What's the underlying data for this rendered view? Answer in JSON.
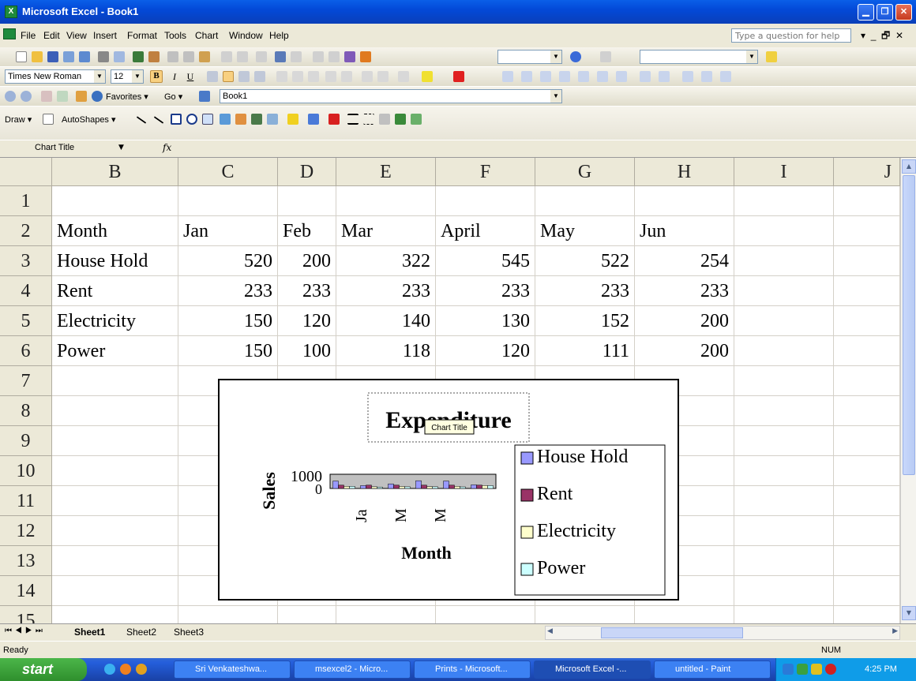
{
  "window": {
    "title": "Microsoft Excel - Book1",
    "app_icon": "excel-icon"
  },
  "menu": {
    "items": [
      "File",
      "Edit",
      "View",
      "Insert",
      "Format",
      "Tools",
      "Chart",
      "Window",
      "Help"
    ],
    "help_placeholder": "Type a question for help"
  },
  "formatting": {
    "font": "Times New Roman",
    "size": "12"
  },
  "web_toolbar": {
    "favorites": "Favorites ▾",
    "go": "Go ▾",
    "address": "Book1"
  },
  "drawing": {
    "draw": "Draw ▾",
    "autoshapes": "AutoShapes ▾"
  },
  "formula_bar": {
    "name_box": "Chart Title",
    "fx": "fx"
  },
  "columns": [
    "B",
    "C",
    "D",
    "E",
    "F",
    "G",
    "H",
    "I",
    "J"
  ],
  "rows": [
    "1",
    "2",
    "3",
    "4",
    "5",
    "6",
    "7",
    "8",
    "9",
    "10",
    "11",
    "12",
    "13",
    "14",
    "15"
  ],
  "table": {
    "header": [
      "Month",
      "Jan",
      "Feb",
      "Mar",
      "April",
      "May",
      "Jun"
    ],
    "data": [
      [
        "House Hold",
        "520",
        "200",
        "322",
        "545",
        "522",
        "254"
      ],
      [
        "Rent",
        "233",
        "233",
        "233",
        "233",
        "233",
        "233"
      ],
      [
        "Electricity",
        "150",
        "120",
        "140",
        "130",
        "152",
        "200"
      ],
      [
        "Power",
        "150",
        "100",
        "118",
        "120",
        "111",
        "200"
      ]
    ]
  },
  "chart": {
    "title": "Expenditure",
    "tooltip": "Chart Title",
    "ylabel": "Sales",
    "xlabel": "Month",
    "ytick_top": "1000",
    "ytick_bottom": "0",
    "xticks": [
      "Ja",
      "M",
      "M"
    ],
    "legend": [
      "House Hold",
      "Rent",
      "Electricity",
      "Power"
    ],
    "colors": [
      "#9999ff",
      "#993366",
      "#ffffcc",
      "#ccffff"
    ]
  },
  "chart_data": {
    "type": "bar",
    "title": "Expenditure",
    "xlabel": "Month",
    "ylabel": "Sales",
    "categories": [
      "Jan",
      "Feb",
      "Mar",
      "April",
      "May",
      "Jun"
    ],
    "ylim": [
      0,
      1000
    ],
    "legend_position": "right",
    "series": [
      {
        "name": "House Hold",
        "values": [
          520,
          200,
          322,
          545,
          522,
          254
        ]
      },
      {
        "name": "Rent",
        "values": [
          233,
          233,
          233,
          233,
          233,
          233
        ]
      },
      {
        "name": "Electricity",
        "values": [
          150,
          120,
          140,
          130,
          152,
          200
        ]
      },
      {
        "name": "Power",
        "values": [
          150,
          100,
          118,
          120,
          111,
          200
        ]
      }
    ]
  },
  "sheets": {
    "tabs": [
      "Sheet1",
      "Sheet2",
      "Sheet3"
    ],
    "active": "Sheet1"
  },
  "status": {
    "left": "Ready",
    "num": "NUM"
  },
  "taskbar": {
    "start": "start",
    "tasks": [
      "Sri Venkateshwa...",
      "msexcel2 - Micro...",
      "Prints - Microsoft...",
      "Microsoft Excel -...",
      "untitled - Paint"
    ],
    "clock": "4:25 PM"
  }
}
